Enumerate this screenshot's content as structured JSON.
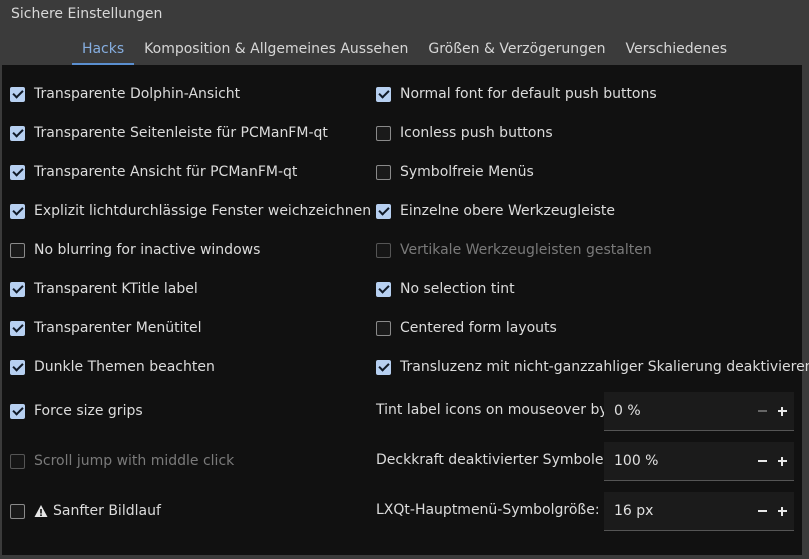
{
  "group_title": "Sichere Einstellungen",
  "tabs": [
    {
      "label": "Hacks",
      "active": true
    },
    {
      "label": "Komposition & Allgemeines Aussehen",
      "active": false
    },
    {
      "label": "Größen & Verzögerungen",
      "active": false
    },
    {
      "label": "Verschiedenes",
      "active": false
    }
  ],
  "left_options": [
    {
      "label": "Transparente Dolphin-Ansicht",
      "checked": true,
      "enabled": true
    },
    {
      "label": "Transparente Seitenleiste für PCManFM-qt",
      "checked": true,
      "enabled": true
    },
    {
      "label": "Transparente Ansicht für PCManFM-qt",
      "checked": true,
      "enabled": true
    },
    {
      "label": "Explizit lichtdurchlässige Fenster weichzeichnen",
      "checked": true,
      "enabled": true
    },
    {
      "label": "No blurring for inactive windows",
      "checked": false,
      "enabled": true
    },
    {
      "label": "Transparent KTitle label",
      "checked": true,
      "enabled": true
    },
    {
      "label": "Transparenter Menütitel",
      "checked": true,
      "enabled": true
    },
    {
      "label": "Dunkle Themen beachten",
      "checked": true,
      "enabled": true
    },
    {
      "label": "Force size grips",
      "checked": true,
      "enabled": true
    },
    {
      "label": "Scroll jump with middle click",
      "checked": false,
      "enabled": false
    },
    {
      "label": "Sanfter Bildlauf",
      "checked": false,
      "enabled": true,
      "icon": "warning-icon"
    }
  ],
  "right_options": [
    {
      "label": "Normal font for default push buttons",
      "checked": true,
      "enabled": true
    },
    {
      "label": "Iconless push buttons",
      "checked": false,
      "enabled": true
    },
    {
      "label": "Symbolfreie Menüs",
      "checked": false,
      "enabled": true
    },
    {
      "label": "Einzelne obere Werkzeugleiste",
      "checked": true,
      "enabled": true
    },
    {
      "label": "Vertikale Werkzeugleisten gestalten",
      "checked": false,
      "enabled": false
    },
    {
      "label": "No selection tint",
      "checked": true,
      "enabled": true
    },
    {
      "label": "Centered form layouts",
      "checked": false,
      "enabled": true
    },
    {
      "label": "Transluzenz mit nicht-ganzzahliger Skalierung deaktivieren",
      "checked": true,
      "enabled": true
    }
  ],
  "spinboxes": [
    {
      "label": "Tint label icons on mouseover by",
      "value": "0 %",
      "minus_enabled": false
    },
    {
      "label": "Deckkraft deaktivierter Symbole:",
      "value": "100 %",
      "minus_enabled": true
    },
    {
      "label": "LXQt-Hauptmenü-Symbolgröße:",
      "value": "16 px",
      "minus_enabled": true
    }
  ],
  "colors": {
    "accent": "#5b8fd0",
    "active_tab_text": "#86aee0",
    "check_fill": "#b7d0f1",
    "panel_bg": "#111111",
    "window_bg": "#3b3b3b"
  }
}
